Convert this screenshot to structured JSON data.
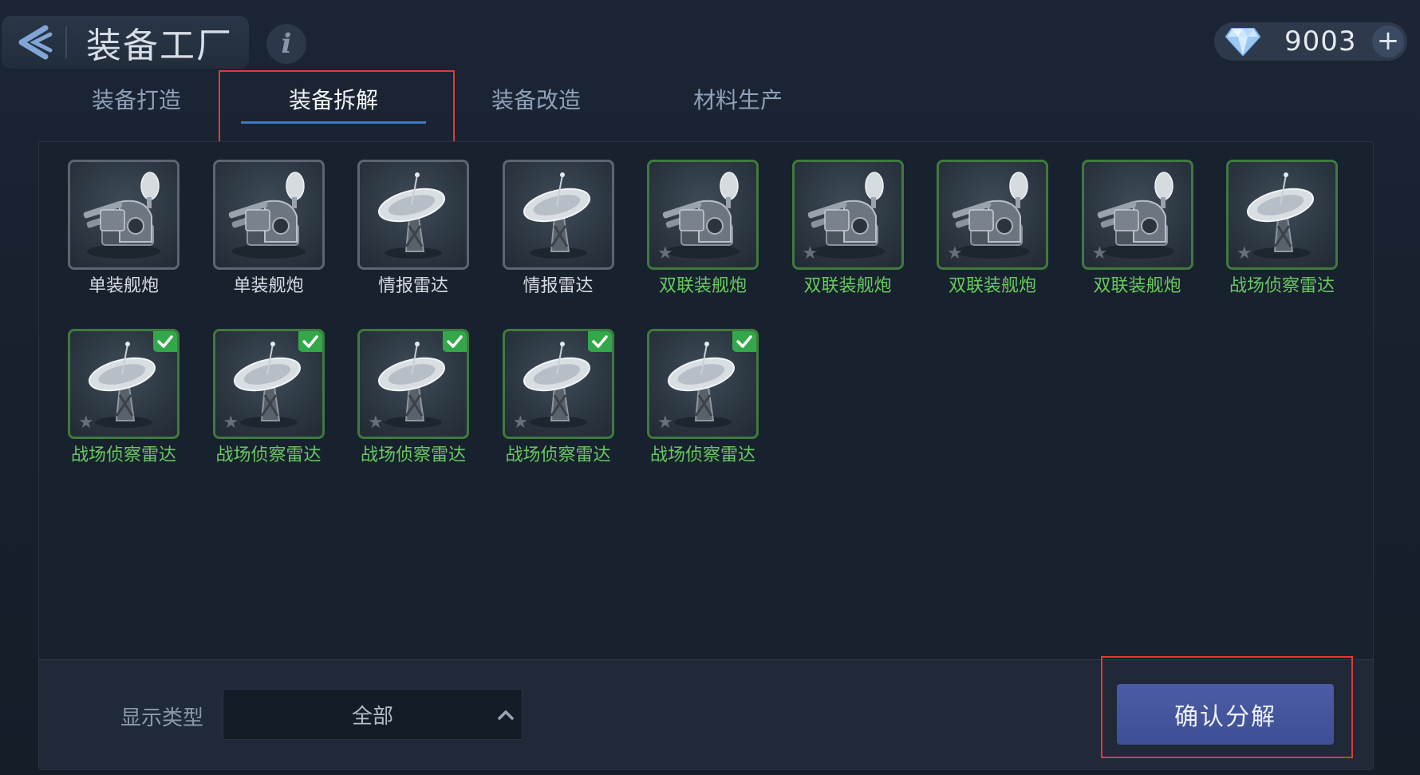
{
  "header": {
    "title": "装备工厂",
    "back_icon": "back-arrow-icon",
    "info_label": "i",
    "currency": {
      "icon": "diamond-icon",
      "amount": "9003",
      "plus_label": "+"
    }
  },
  "tabs": [
    {
      "label": "装备打造",
      "active": false
    },
    {
      "label": "装备拆解",
      "active": true
    },
    {
      "label": "装备改造",
      "active": false
    },
    {
      "label": "材料生产",
      "active": false
    }
  ],
  "items_row1": [
    {
      "name": "单装舰炮",
      "type": "gun",
      "rarity": "gray",
      "selected": false
    },
    {
      "name": "单装舰炮",
      "type": "gun",
      "rarity": "gray",
      "selected": false
    },
    {
      "name": "情报雷达",
      "type": "radar",
      "rarity": "gray",
      "selected": false
    },
    {
      "name": "情报雷达",
      "type": "radar",
      "rarity": "gray",
      "selected": false
    },
    {
      "name": "双联装舰炮",
      "type": "gun",
      "rarity": "green",
      "selected": false
    },
    {
      "name": "双联装舰炮",
      "type": "gun",
      "rarity": "green",
      "selected": false
    },
    {
      "name": "双联装舰炮",
      "type": "gun",
      "rarity": "green",
      "selected": false
    },
    {
      "name": "双联装舰炮",
      "type": "gun",
      "rarity": "green",
      "selected": false
    },
    {
      "name": "战场侦察雷达",
      "type": "radar",
      "rarity": "green",
      "selected": false
    }
  ],
  "items_row2": [
    {
      "name": "战场侦察雷达",
      "type": "radar",
      "rarity": "green",
      "selected": true
    },
    {
      "name": "战场侦察雷达",
      "type": "radar",
      "rarity": "green",
      "selected": true
    },
    {
      "name": "战场侦察雷达",
      "type": "radar",
      "rarity": "green",
      "selected": true
    },
    {
      "name": "战场侦察雷达",
      "type": "radar",
      "rarity": "green",
      "selected": true
    },
    {
      "name": "战场侦察雷达",
      "type": "radar",
      "rarity": "green",
      "selected": true
    }
  ],
  "footer": {
    "filter_label": "显示类型",
    "filter_value": "全部",
    "confirm_label": "确认分解"
  },
  "colors": {
    "green_name": "#67c95f",
    "gray_name": "#d6dbe2",
    "check": "#33a84a",
    "confirm_button": "#4555a0",
    "highlight_box": "#e23a35"
  }
}
